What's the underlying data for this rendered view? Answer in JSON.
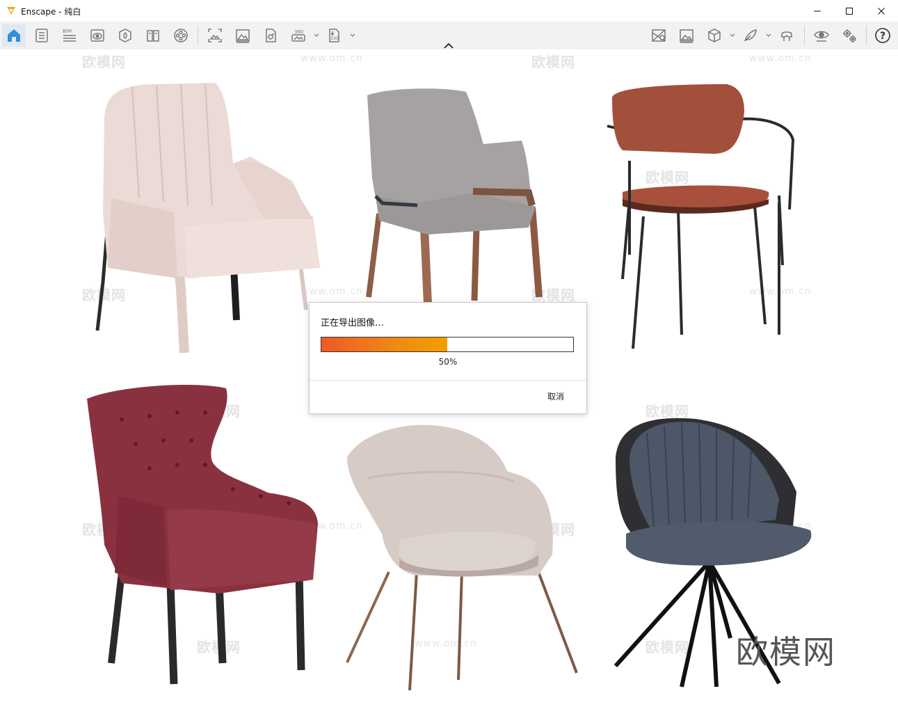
{
  "window": {
    "app_name": "Enscape - 纯白",
    "accent_color": "#f5a623"
  },
  "toolbar": {
    "left_items": [
      {
        "name": "home-icon",
        "active": true
      },
      {
        "name": "document-list-icon"
      },
      {
        "name": "bim-icon",
        "label": "BIM"
      },
      {
        "name": "visual-settings-icon"
      },
      {
        "name": "asset-library-icon"
      },
      {
        "name": "material-editor-icon"
      },
      {
        "name": "video-reel-icon"
      },
      {
        "name": "screenshot-icon"
      },
      {
        "name": "image-export-icon"
      },
      {
        "name": "batch-render-icon"
      },
      {
        "name": "panorama-icon",
        "label": "360"
      },
      {
        "name": "exe-export-icon",
        "label": "EXE"
      }
    ],
    "right_items": [
      {
        "name": "map-icon"
      },
      {
        "name": "image-gallery-icon"
      },
      {
        "name": "cube-icon"
      },
      {
        "name": "feather-icon"
      },
      {
        "name": "vr-headset-icon"
      },
      {
        "name": "view-settings-icon"
      },
      {
        "name": "gear-icon"
      },
      {
        "name": "help-icon",
        "label": "?"
      }
    ]
  },
  "viewport": {
    "watermark": "欧模网",
    "watermark_url": "www.om.cn",
    "brand_corner": "欧模网",
    "chairs": [
      {
        "name": "pink-leather-armchair",
        "color": "#ead8d3"
      },
      {
        "name": "grey-fabric-chair",
        "color": "#a7a2a2"
      },
      {
        "name": "rust-leather-chair",
        "color": "#a24f3b"
      },
      {
        "name": "burgundy-tufted-armchair",
        "color": "#8a3140"
      },
      {
        "name": "beige-leather-armchair",
        "color": "#d6cbc5"
      },
      {
        "name": "navy-channel-chair",
        "color": "#4e5767"
      }
    ]
  },
  "export_dialog": {
    "title": "正在导出图像…",
    "progress": 0.5,
    "progress_label": "50%",
    "cancel_label": "取消"
  }
}
